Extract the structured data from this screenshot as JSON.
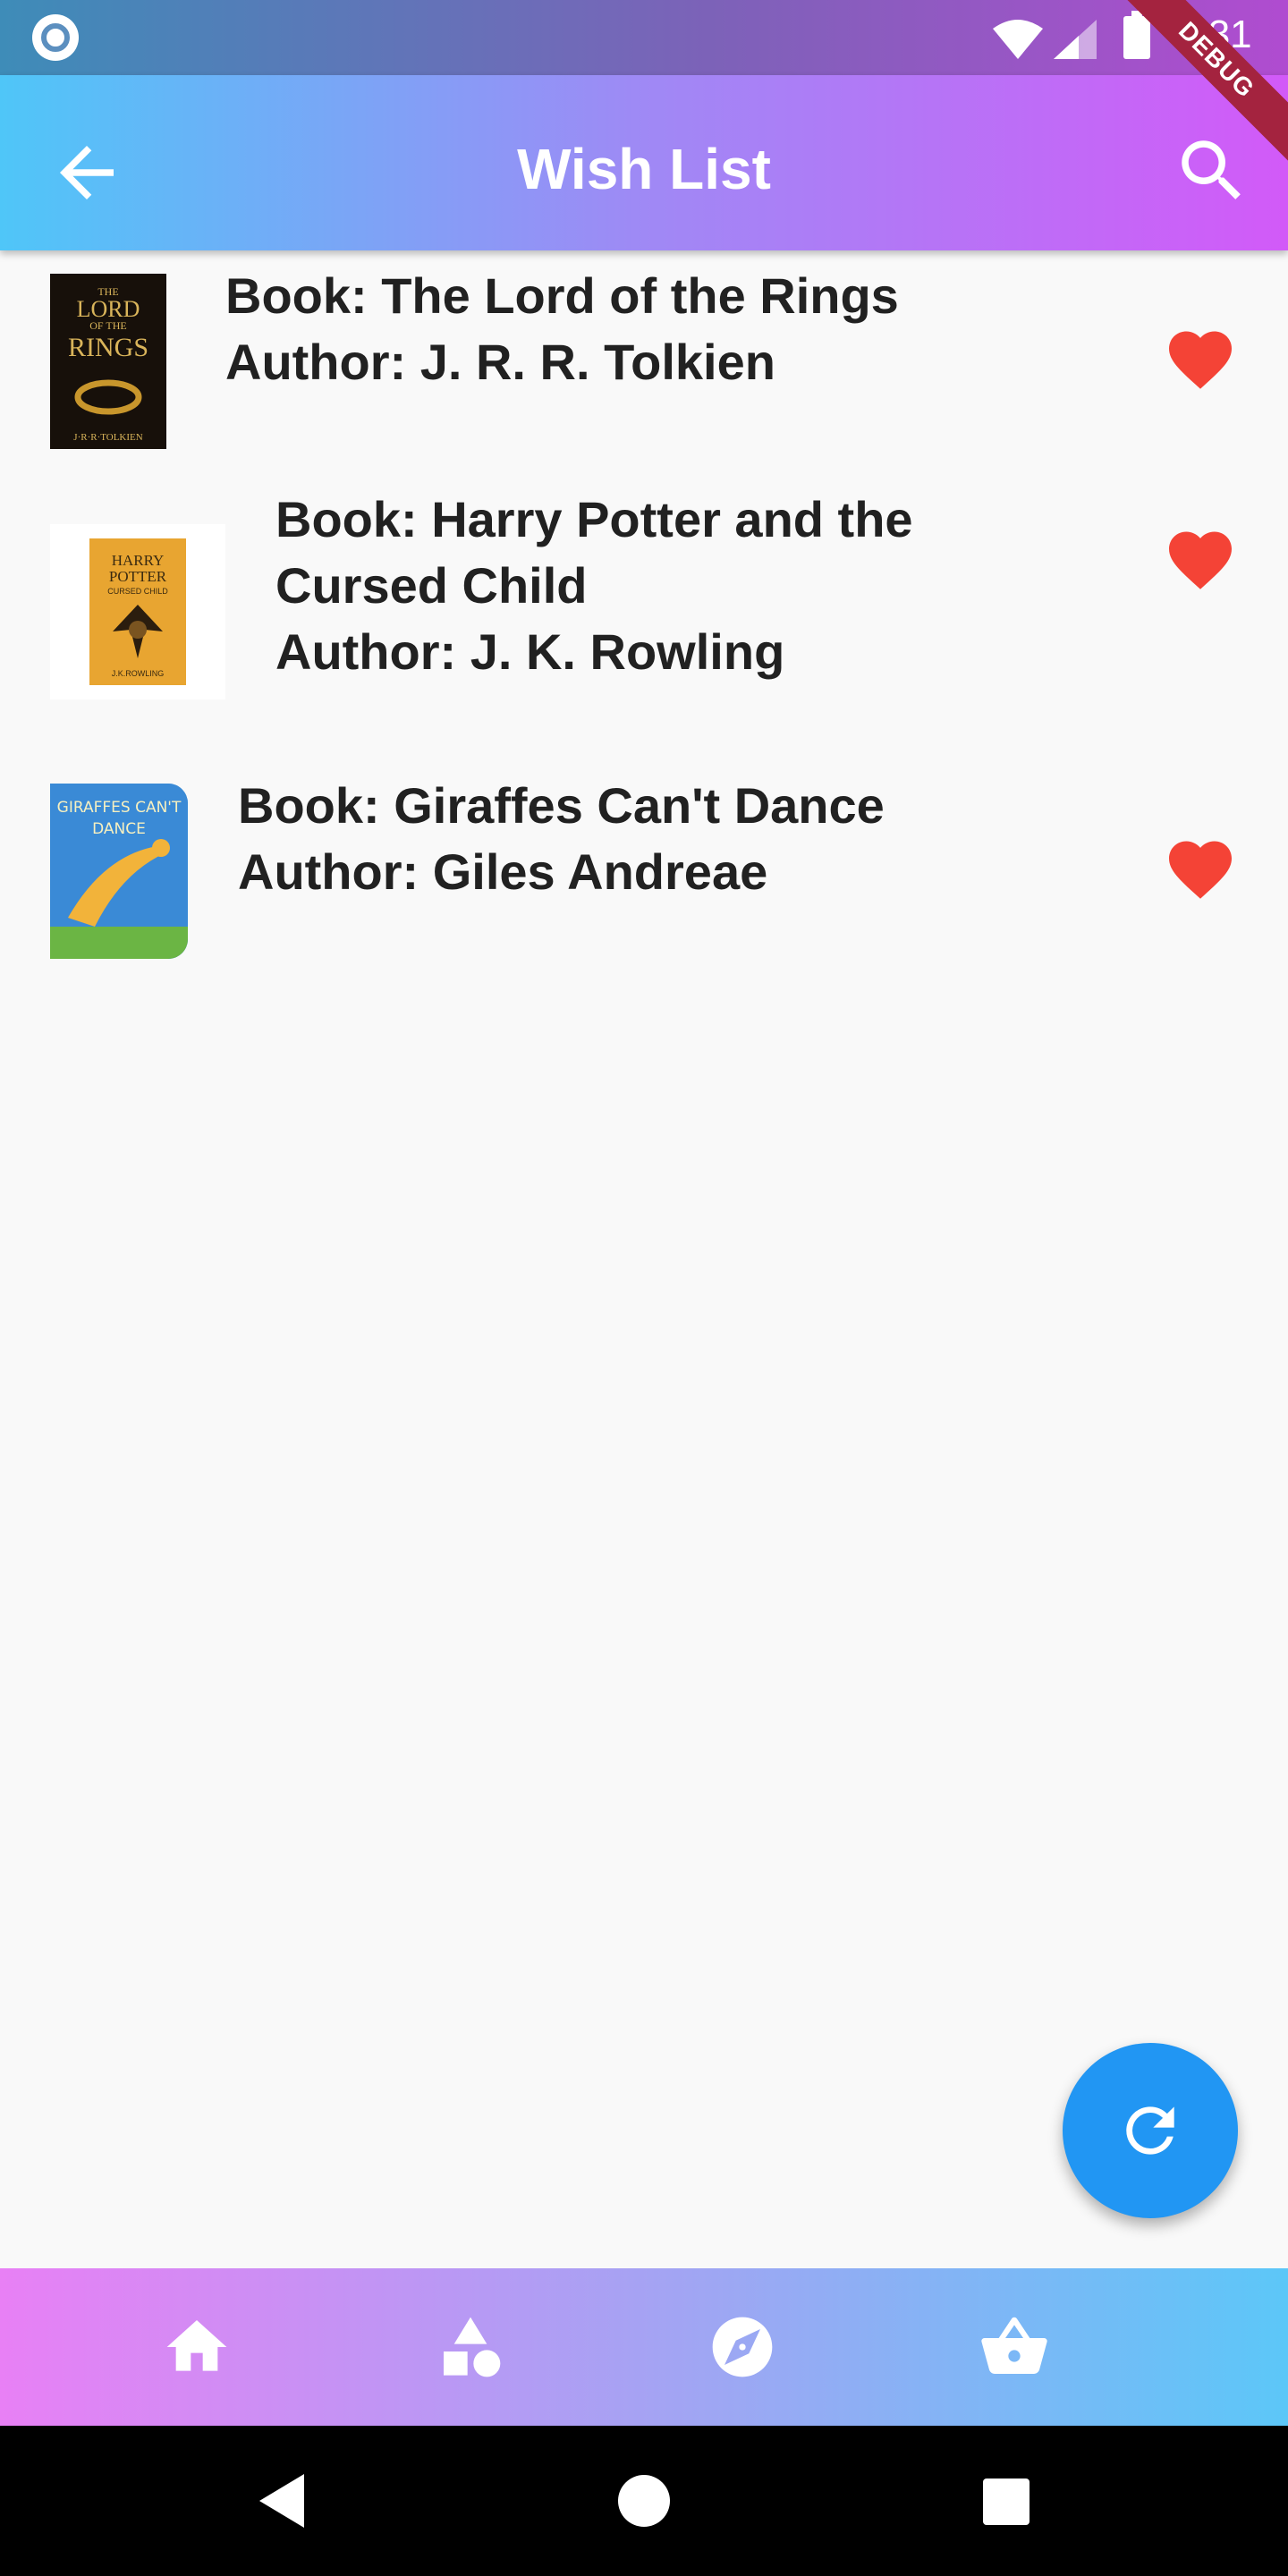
{
  "status_bar": {
    "time": "1:31",
    "debug_label": "DEBUG"
  },
  "app_bar": {
    "title": "Wish List",
    "back_icon": "arrow-back-icon",
    "search_icon": "search-icon"
  },
  "books": [
    {
      "title_line": "Book: The Lord of the Rings",
      "author_line": "Author: J. R. R. Tolkien",
      "cover_icon": "lord-of-the-rings-cover",
      "cover_lines": [
        "THE",
        "LORD",
        "OF THE",
        "RINGS",
        "J·R·R·TOLKIEN"
      ],
      "favorite": true
    },
    {
      "title_line": "Book: Harry Potter and the Cursed Child",
      "author_line": "Author: J. K. Rowling",
      "cover_icon": "harry-potter-cursed-child-cover",
      "cover_lines": [
        "HARRY",
        "POTTER",
        "CURSED CHILD",
        "J.K.ROWLING"
      ],
      "favorite": true
    },
    {
      "title_line": "Book: Giraffes Can't Dance",
      "author_line": "Author: Giles Andreae",
      "cover_icon": "giraffes-cant-dance-cover",
      "cover_lines": [
        "GIRAFFES CAN'T",
        "DANCE"
      ],
      "favorite": true
    }
  ],
  "fab": {
    "icon": "refresh-icon"
  },
  "bottom_nav": [
    "home-icon",
    "category-icon",
    "explore-icon",
    "basket-icon"
  ],
  "system_nav": [
    "back-triangle-icon",
    "home-circle-icon",
    "recents-square-icon"
  ],
  "colors": {
    "heart": "#f44336",
    "fab": "#2196f3",
    "debug_ribbon": "#a4233f"
  }
}
